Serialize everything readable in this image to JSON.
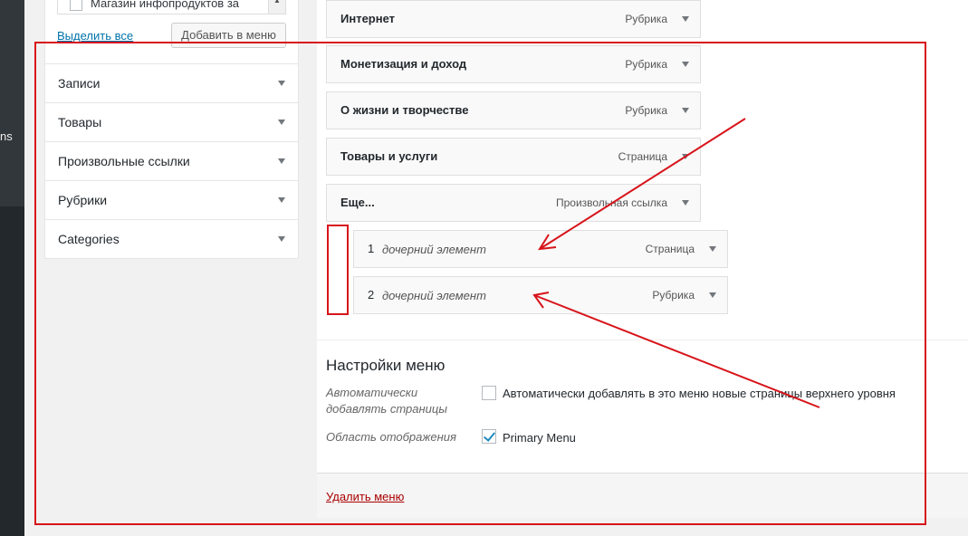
{
  "sidebar": {
    "partial_text": "ns"
  },
  "left_panel": {
    "category_checkbox_label": "Магазин инфопродуктов за",
    "select_all": "Выделить все",
    "add_to_menu": "Добавить в меню",
    "accordion": [
      {
        "label": "Записи"
      },
      {
        "label": "Товары"
      },
      {
        "label": "Произвольные ссылки"
      },
      {
        "label": "Рубрики"
      },
      {
        "label": "Categories"
      }
    ]
  },
  "menu_items": [
    {
      "title": "Интернет",
      "type": "Рубрика"
    },
    {
      "title": "Монетизация и доход",
      "type": "Рубрика"
    },
    {
      "title": "О жизни и творчестве",
      "type": "Рубрика"
    },
    {
      "title": "Товары и услуги",
      "type": "Страница"
    },
    {
      "title": "Еще...",
      "type": "Произвольная ссылка"
    }
  ],
  "child_items": [
    {
      "num": "1",
      "title": "дочерний элемент",
      "type": "Страница"
    },
    {
      "num": "2",
      "title": "дочерний элемент",
      "type": "Рубрика"
    }
  ],
  "menu_settings": {
    "title": "Настройки меню",
    "auto_add_label": "Автоматически добавлять страницы",
    "auto_add_text": "Автоматически добавлять в это меню новые страницы верхнего уровня",
    "auto_add_checked": false,
    "display_location_label": "Область отображения",
    "primary_menu_text": "Primary Menu",
    "primary_menu_checked": true
  },
  "footer": {
    "delete_menu": "Удалить меню"
  },
  "annotation_colors": {
    "highlight": "#d7141a"
  }
}
